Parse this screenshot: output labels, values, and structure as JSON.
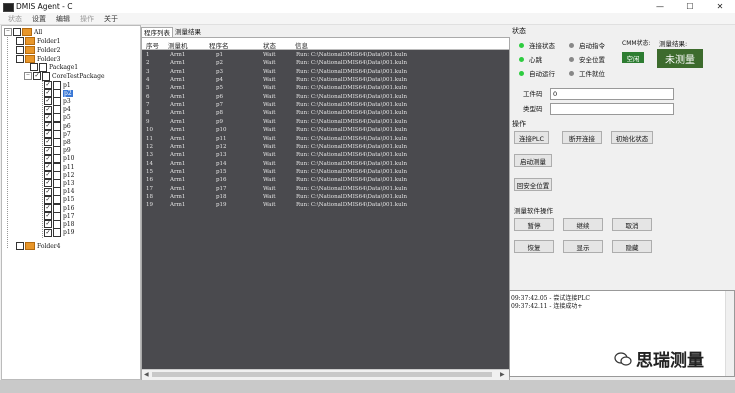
{
  "window": {
    "title": "DMIS Agent - C",
    "min_glyph": "—",
    "max_glyph": "☐",
    "close_glyph": "✕"
  },
  "menu": [
    {
      "label": "状态",
      "disabled": true
    },
    {
      "label": "设置",
      "disabled": false
    },
    {
      "label": "编辑",
      "disabled": false
    },
    {
      "label": "操作",
      "disabled": true
    },
    {
      "label": "关于",
      "disabled": false
    }
  ],
  "tree": {
    "root": "All",
    "folders": [
      "Folder1",
      "Folder2",
      "Folder3",
      "Folder4"
    ],
    "package": "Package1",
    "core_package": "CoreTestPackage",
    "programs": [
      "p1",
      "p2",
      "p3",
      "p4",
      "p5",
      "p6",
      "p7",
      "p8",
      "p9",
      "p10",
      "p11",
      "p12",
      "p13",
      "p14",
      "p15",
      "p16",
      "p17",
      "p18",
      "p19"
    ],
    "selected": "p2"
  },
  "tabs": [
    "程序列表",
    "测量结果"
  ],
  "grid": {
    "headers": [
      "序号",
      "测量机",
      "程序名",
      "状态",
      "信息"
    ],
    "rows": [
      [
        "1",
        "Arm1",
        "p1",
        "Wait",
        "Run: C:\\NationalDMIS64\\Data\\001.kuln"
      ],
      [
        "2",
        "Arm1",
        "p2",
        "Wait",
        "Run: C:\\NationalDMIS64\\Data\\001.kuln"
      ],
      [
        "3",
        "Arm1",
        "p3",
        "Wait",
        "Run: C:\\NationalDMIS64\\Data\\001.kuln"
      ],
      [
        "4",
        "Arm1",
        "p4",
        "Wait",
        "Run: C:\\NationalDMIS64\\Data\\001.kuln"
      ],
      [
        "5",
        "Arm1",
        "p5",
        "Wait",
        "Run: C:\\NationalDMIS64\\Data\\001.kuln"
      ],
      [
        "6",
        "Arm1",
        "p6",
        "Wait",
        "Run: C:\\NationalDMIS64\\Data\\001.kuln"
      ],
      [
        "7",
        "Arm1",
        "p7",
        "Wait",
        "Run: C:\\NationalDMIS64\\Data\\001.kuln"
      ],
      [
        "8",
        "Arm1",
        "p8",
        "Wait",
        "Run: C:\\NationalDMIS64\\Data\\001.kuln"
      ],
      [
        "9",
        "Arm1",
        "p9",
        "Wait",
        "Run: C:\\NationalDMIS64\\Data\\001.kuln"
      ],
      [
        "10",
        "Arm1",
        "p10",
        "Wait",
        "Run: C:\\NationalDMIS64\\Data\\001.kuln"
      ],
      [
        "11",
        "Arm1",
        "p11",
        "Wait",
        "Run: C:\\NationalDMIS64\\Data\\001.kuln"
      ],
      [
        "12",
        "Arm1",
        "p12",
        "Wait",
        "Run: C:\\NationalDMIS64\\Data\\001.kuln"
      ],
      [
        "13",
        "Arm1",
        "p13",
        "Wait",
        "Run: C:\\NationalDMIS64\\Data\\001.kuln"
      ],
      [
        "14",
        "Arm1",
        "p14",
        "Wait",
        "Run: C:\\NationalDMIS64\\Data\\001.kuln"
      ],
      [
        "15",
        "Arm1",
        "p15",
        "Wait",
        "Run: C:\\NationalDMIS64\\Data\\001.kuln"
      ],
      [
        "16",
        "Arm1",
        "p16",
        "Wait",
        "Run: C:\\NationalDMIS64\\Data\\001.kuln"
      ],
      [
        "17",
        "Arm1",
        "p17",
        "Wait",
        "Run: C:\\NationalDMIS64\\Data\\001.kuln"
      ],
      [
        "18",
        "Arm1",
        "p18",
        "Wait",
        "Run: C:\\NationalDMIS64\\Data\\001.kuln"
      ],
      [
        "19",
        "Arm1",
        "p19",
        "Wait",
        "Run: C:\\NationalDMIS64\\Data\\001.kuln"
      ]
    ]
  },
  "status": {
    "section": "状态",
    "indicators": [
      {
        "label": "连接状态",
        "color": "#2ecc40"
      },
      {
        "label": "启动指令",
        "color": "#888888"
      },
      {
        "label": "心跳",
        "color": "#2ecc40"
      },
      {
        "label": "安全位置",
        "color": "#888888"
      },
      {
        "label": "自动运行",
        "color": "#2ecc40"
      },
      {
        "label": "工件就位",
        "color": "#888888"
      }
    ],
    "cmm_label": "CMM状态:",
    "cmm_value": "空闲",
    "result_label": "测量结果:",
    "result_value": "未测量",
    "cmm_color": "#2e7d32",
    "result_color": "#3d6b2d"
  },
  "fields": {
    "workpiece_label": "工件码",
    "workpiece_value": "0",
    "type_label": "类型码",
    "type_value": ""
  },
  "ops": {
    "section": "操作",
    "buttons": [
      "连接PLC",
      "断开连接",
      "初始化状态",
      "启动测量",
      "回安全位置"
    ]
  },
  "meas_ops": {
    "section": "测量软件操作",
    "buttons": [
      "暂停",
      "继续",
      "取消",
      "恢复",
      "显示",
      "隐藏"
    ]
  },
  "log": [
    "09:37:42.05 - 尝试连接PLC",
    "09:37:42.11 - 连接成功+"
  ],
  "watermark": {
    "text": "思瑞测量"
  }
}
